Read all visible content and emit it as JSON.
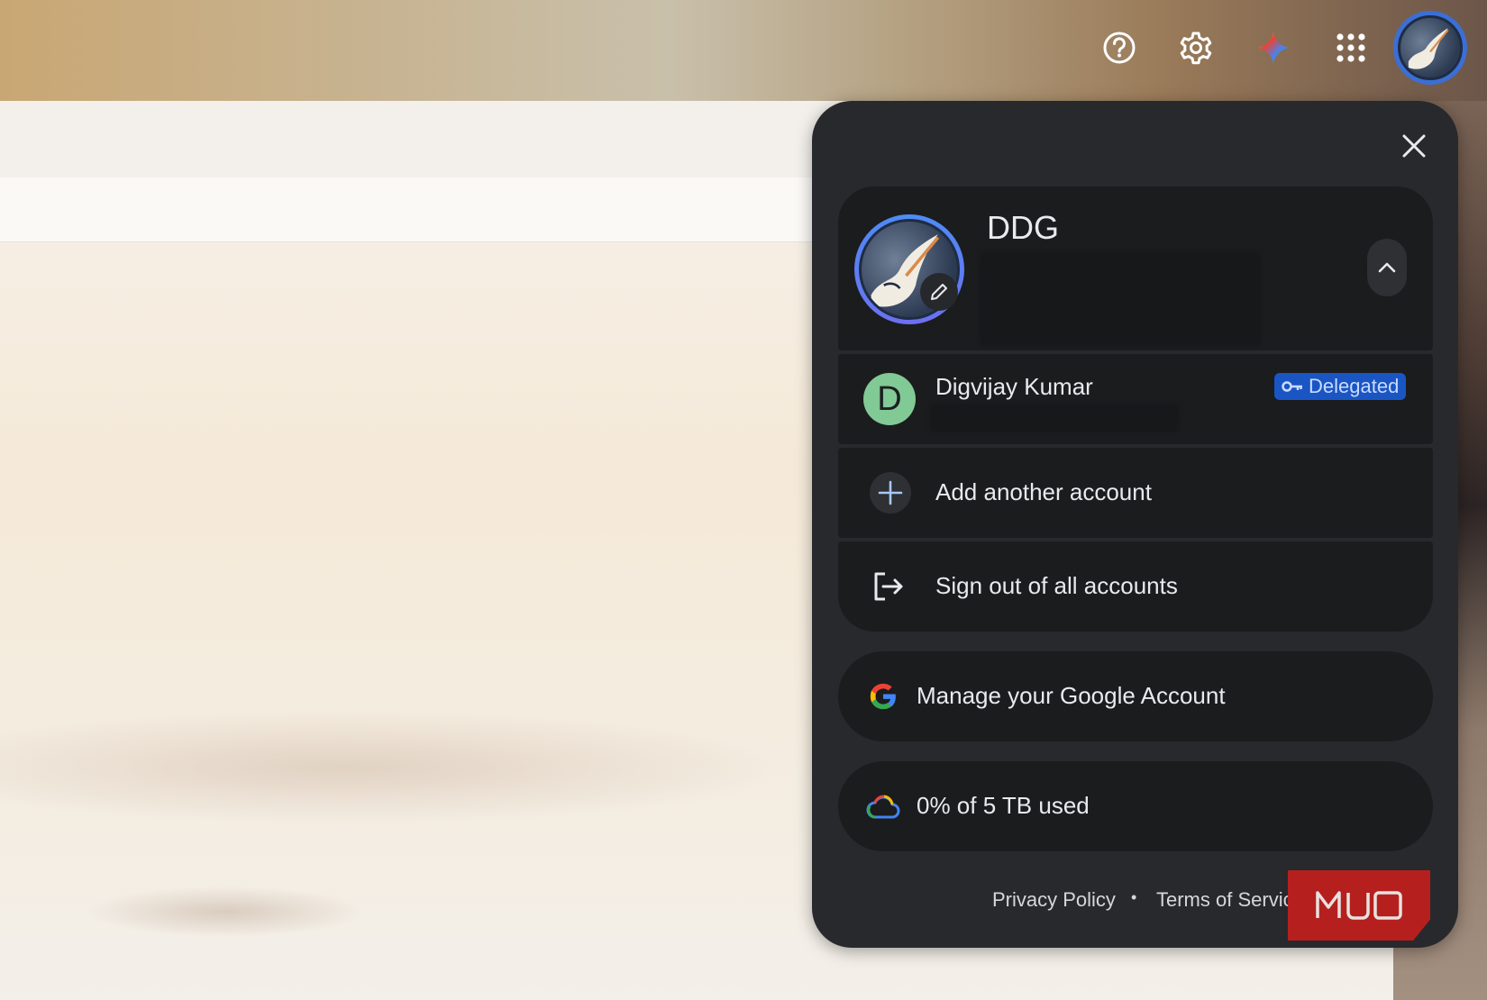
{
  "top_icons": [
    "help-icon",
    "settings-icon",
    "gemini-icon",
    "apps-grid-icon"
  ],
  "panel": {
    "account_name": "DDG",
    "delegated_account": {
      "initial": "D",
      "name": "Digvijay Kumar",
      "badge": "Delegated"
    },
    "add_account_label": "Add another account",
    "sign_out_label": "Sign out of all accounts",
    "manage_account_label": "Manage your Google Account",
    "storage_label": "0% of 5 TB used",
    "footer": {
      "privacy": "Privacy Policy",
      "separator": "•",
      "terms": "Terms of Service"
    }
  },
  "watermark": "MUO",
  "colors": {
    "panel_bg": "#28292c",
    "card_bg": "#1b1c1e",
    "delegated_badge": "#1a55c4",
    "avatar_ring": "#4c8df6",
    "initial_avatar": "#81c995",
    "watermark": "#b5201e"
  }
}
